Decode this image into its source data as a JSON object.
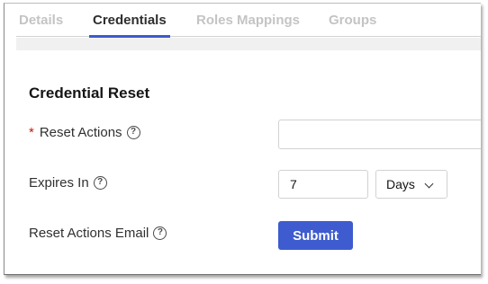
{
  "tabs": {
    "details": "Details",
    "credentials": "Credentials",
    "roles_mappings": "Roles Mappings",
    "groups": "Groups"
  },
  "section": {
    "title": "Credential Reset"
  },
  "form": {
    "required_marker": "*",
    "help_glyph": "?",
    "reset_actions": {
      "label": "Reset Actions",
      "value": ""
    },
    "expires_in": {
      "label": "Expires In",
      "value": "7",
      "unit": "Days"
    },
    "reset_actions_email": {
      "label": "Reset Actions Email",
      "button": "Submit"
    }
  },
  "colors": {
    "accent": "#3e5ccf",
    "required": "#c9190b",
    "tab_inactive": "#c4c4c4",
    "tab_active": "#2e2e2e"
  }
}
